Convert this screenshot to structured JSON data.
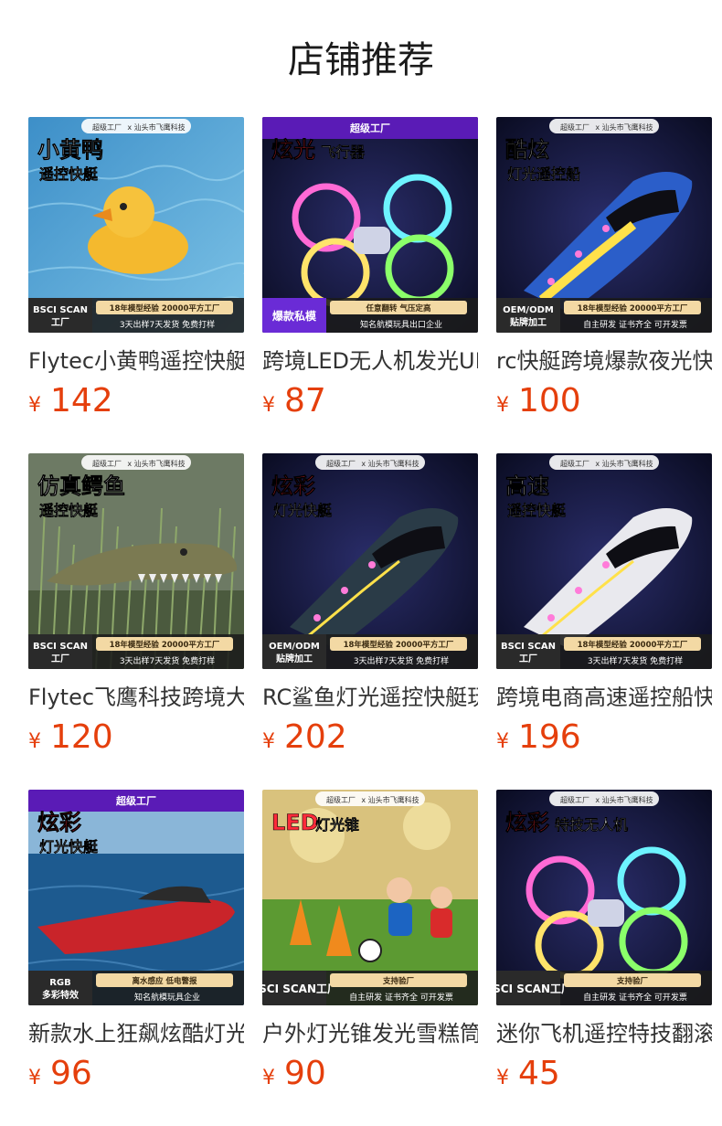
{
  "page": {
    "title": "店铺推荐"
  },
  "currency": "¥",
  "brand": {
    "super_factory": "超级工厂",
    "partner": "x 汕头市飞鹰科技"
  },
  "products": [
    {
      "name": "Flytec小黄鸭遥控快艇",
      "price": "142",
      "banner_title": "小黄鸭",
      "banner_sub": "遥控快艇",
      "left_badge": "BSCI SCAN\n工厂",
      "badge_line1": "18年模型经验 20000平方工厂",
      "badge_line2": "3天出样7天发货  免费打样"
    },
    {
      "name": "跨境LED无人机发光UFO",
      "price": "87",
      "banner_title": "炫光",
      "banner_sub": "飞行器",
      "left_badge": "爆款私模",
      "badge_line1": "任意翻转 气压定高",
      "badge_line2": "知名航模玩具出口企业"
    },
    {
      "name": "rc快艇跨境爆款夜光快艇",
      "price": "100",
      "banner_title": "酷炫",
      "banner_sub": "灯光遥控船",
      "left_badge": "OEM/ODM\n贴牌加工",
      "badge_line1": "18年模型经验 20000平方工厂",
      "badge_line2": "自主研发  证书齐全  可开发票"
    },
    {
      "name": "Flytec飞鹰科技跨境大鳄鱼",
      "price": "120",
      "banner_title": "仿真鳄鱼",
      "banner_sub": "遥控快艇",
      "left_badge": "BSCI SCAN\n工厂",
      "badge_line1": "18年模型经验 20000平方工厂",
      "badge_line2": "3天出样7天发货  免费打样"
    },
    {
      "name": "RC鲨鱼灯光遥控快艇玩具",
      "price": "202",
      "banner_title": "炫彩",
      "banner_sub": "灯光快艇",
      "left_badge": "OEM/ODM\n贴牌加工",
      "badge_line1": "18年模型经验 20000平方工厂",
      "badge_line2": "3天出样7天发货  免费打样"
    },
    {
      "name": "跨境电商高速遥控船快艇",
      "price": "196",
      "banner_title": "高速",
      "banner_sub": "遥控快艇",
      "left_badge": "BSCI SCAN\n工厂",
      "badge_line1": "18年模型经验 20000平方工厂",
      "badge_line2": "3天出样7天发货  免费打样"
    },
    {
      "name": "新款水上狂飙炫酷灯光快艇",
      "price": "96",
      "banner_title": "炫彩",
      "banner_sub": "灯光快艇",
      "left_badge": "RGB\n多彩特效",
      "badge_line1": "离水感应 低电警报",
      "badge_line2": "知名航模玩具企业"
    },
    {
      "name": "户外灯光锥发光雪糕筒",
      "price": "90",
      "banner_title": "LED",
      "banner_sub": "灯光锥",
      "left_badge": "BSCI SCAN工厂",
      "badge_line1": "支持验厂",
      "badge_line2": "自主研发  证书齐全  可开发票"
    },
    {
      "name": "迷你飞机遥控特技翻滚无人机",
      "price": "45",
      "banner_title": "炫彩",
      "banner_sub": "特技无人机",
      "left_badge": "BSCI SCAN工厂",
      "badge_line1": "支持验厂",
      "badge_line2": "自主研发  证书齐全  可开发票"
    }
  ],
  "colors": {
    "price": "#e53f0c",
    "title": "#1a1a1a",
    "name": "#333333"
  }
}
